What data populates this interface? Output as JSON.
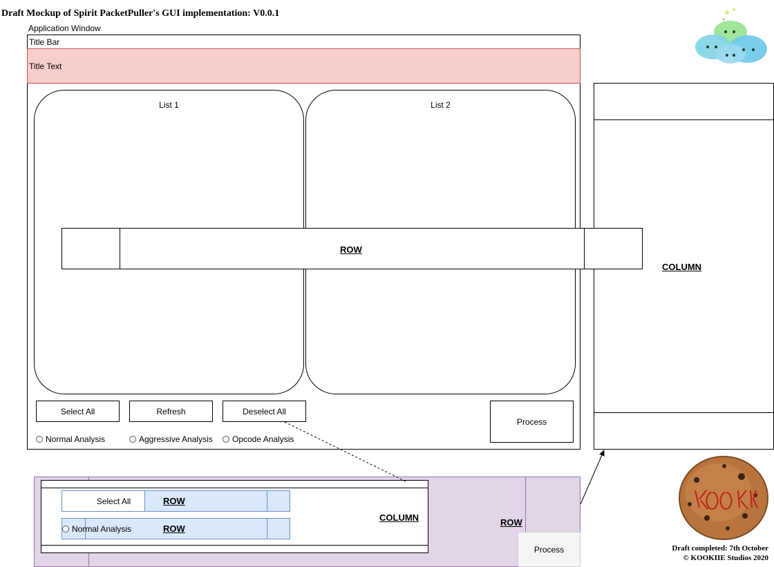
{
  "header": {
    "title": "Draft Mockup of Spirit PacketPuller's GUI implementation: V0.0.1"
  },
  "window": {
    "label": "Application Window",
    "title_bar": "Title Bar",
    "title_text": "Title Text",
    "title_text_color": "#f8cecc"
  },
  "lists": [
    {
      "label": "List 1"
    },
    {
      "label": "List 2"
    }
  ],
  "row_overlay": {
    "label": "ROW"
  },
  "column_panel": {
    "label": "COLUMN"
  },
  "buttons": {
    "select_all": "Select All",
    "refresh": "Refresh",
    "deselect_all": "Deselect All",
    "process": "Process"
  },
  "radios": {
    "normal": "Normal Analysis",
    "aggressive": "Aggressive Analysis",
    "opcode": "Opcode Analysis"
  },
  "detail": {
    "outer_color": "#e1d5e7",
    "inner_color": "#dae8fc",
    "select_all": "Select All",
    "normal_analysis": "Normal Analysis",
    "row_label_1": "ROW",
    "row_label_2": "ROW",
    "column_label": "COLUMN",
    "outer_row_label": "ROW",
    "process": "Process"
  },
  "credits": {
    "line1": "Draft completed: 7th October",
    "line2": "© KOOKIIE Studios 2020"
  },
  "logos": {
    "slime_logo": "KOOKIE",
    "cookie_logo": "KOOKIE"
  }
}
